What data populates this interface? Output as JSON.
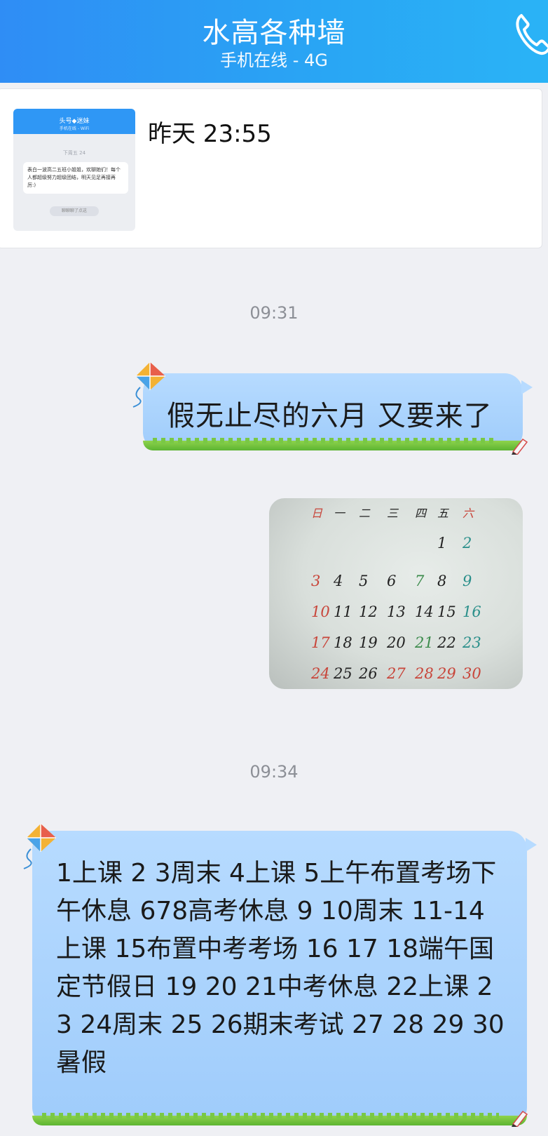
{
  "header": {
    "title": "水高各种墙",
    "subtitle": "手机在线 - 4G"
  },
  "forward_card": {
    "date": "昨天 23:55",
    "thumb": {
      "title": "头号◆迷妹",
      "subtitle": "手机在线 - WiFi",
      "time": "下周五 24",
      "message": "表白一波高二五班小姐姐，欢聊她们！每个人都超级努力超级团结，明天见足再接再厉:)",
      "pill": "聊聊聊了点这"
    }
  },
  "messages": [
    {
      "time": "09:31",
      "text": "假无止尽的六月 又要来了"
    },
    {
      "time": "09:34",
      "text": "1上课   2 3周末   4上课   5上午布置考场下午休息 678高考休息   9 10周末   11-14上课   15布置中考考场   16 17 18端午国定节假日 19 20 21中考休息   22上课   23 24周末    25 26期末考试    27 28 29 30暑假"
    }
  ],
  "calendar_photo": {
    "weekdays": [
      "日",
      "一",
      "二",
      "三",
      "四",
      "五",
      "六"
    ],
    "days": [
      "1",
      "2",
      "3",
      "4",
      "5",
      "6",
      "7",
      "8",
      "9",
      "10",
      "11",
      "12",
      "13",
      "14",
      "15",
      "16",
      "17",
      "18",
      "19",
      "20",
      "21",
      "22",
      "23",
      "24",
      "25",
      "26",
      "27",
      "28",
      "29",
      "30"
    ],
    "colors": {
      "red": "#c8453a",
      "black": "#222222",
      "teal": "#2a8f8a",
      "green": "#3d8c4d"
    }
  }
}
